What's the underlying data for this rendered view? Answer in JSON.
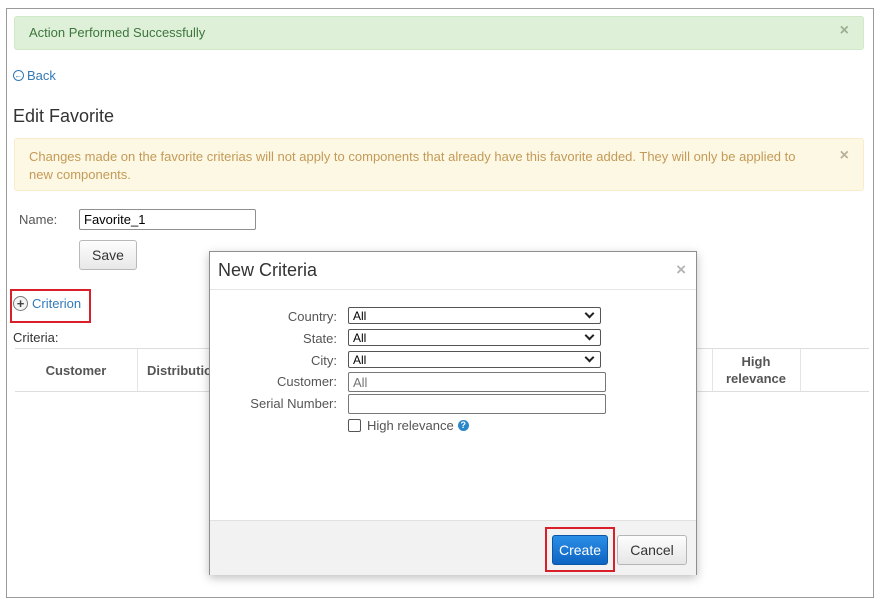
{
  "success_alert": {
    "text": "Action Performed Successfully",
    "close": "×"
  },
  "back_link": {
    "label": "Back"
  },
  "page_title": "Edit Favorite",
  "warning_alert": {
    "text": "Changes made on the favorite criterias will not apply to components that already have this favorite added. They will only be applied to new components.",
    "close": "×"
  },
  "form": {
    "name_label": "Name:",
    "name_value": "Favorite_1",
    "save_label": "Save"
  },
  "criterion_link": {
    "label": "Criterion"
  },
  "criteria_label": "Criteria:",
  "table": {
    "headers": [
      "Customer",
      "Distribution",
      "High relevance"
    ]
  },
  "modal": {
    "title": "New Criteria",
    "close": "×",
    "fields": {
      "country": {
        "label": "Country:",
        "value": "All"
      },
      "state": {
        "label": "State:",
        "value": "All"
      },
      "city": {
        "label": "City:",
        "value": "All"
      },
      "customer": {
        "label": "Customer:",
        "placeholder": "All"
      },
      "serial_number": {
        "label": "Serial Number:",
        "value": ""
      }
    },
    "high_relevance_label": "High relevance",
    "help_icon": "?",
    "create_label": "Create",
    "cancel_label": "Cancel"
  },
  "colors": {
    "link": "#337ab7",
    "success_bg": "#dff0d8",
    "warning_bg": "#fcf8e3",
    "primary": "#1a78d6",
    "highlight": "#d9202a"
  }
}
